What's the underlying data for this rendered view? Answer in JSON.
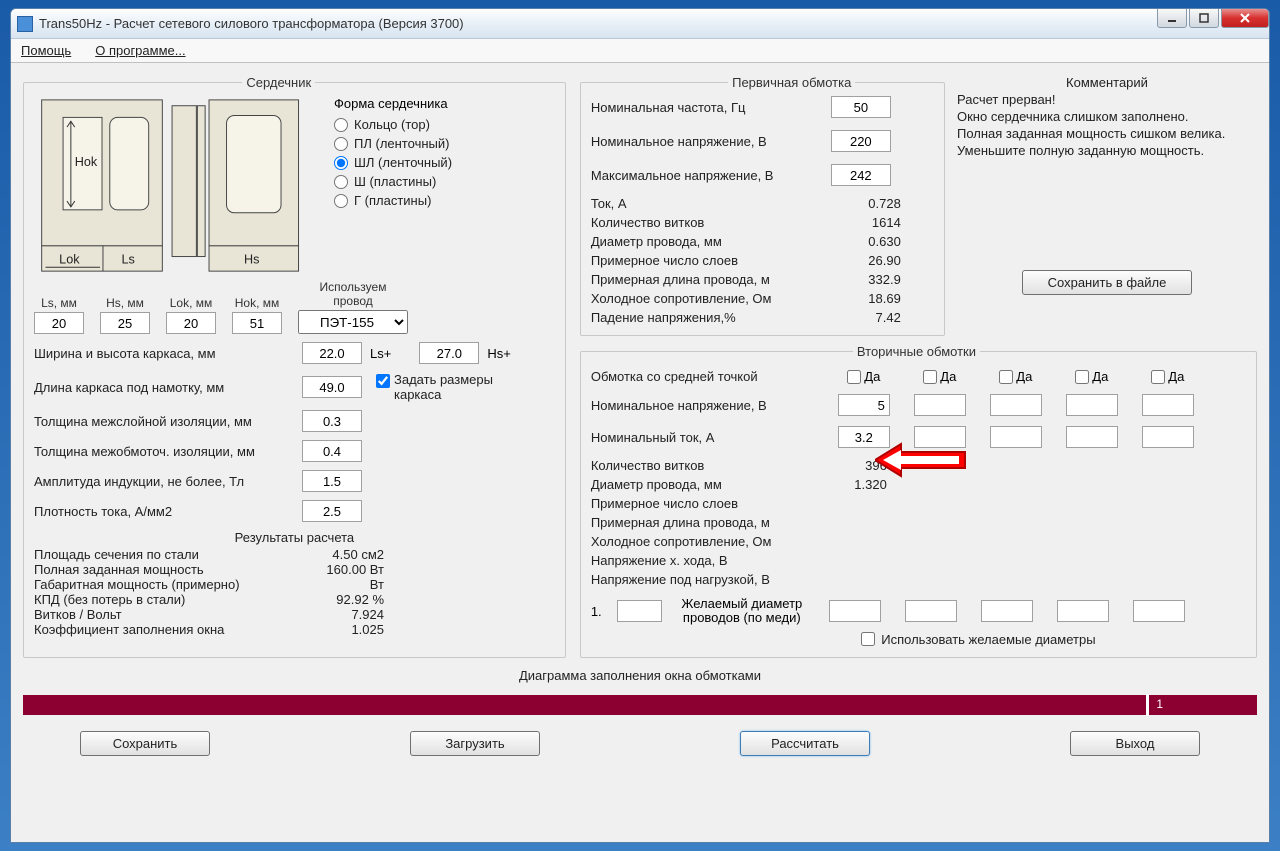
{
  "window": {
    "title": "Trans50Hz - Расчет сетевого силового трансформатора (Версия 3700)"
  },
  "menu": {
    "help": "Помощь",
    "about": "О программе..."
  },
  "core": {
    "legend": "Сердечник",
    "shape_label": "Форма сердечника",
    "shapes": {
      "ring": "Кольцо (тор)",
      "pl": "ПЛ (ленточный)",
      "shl": "ШЛ (ленточный)",
      "sh": "Ш  (пластины)",
      "g": "Г (пластины)"
    },
    "diagram": {
      "hok": "Hok",
      "lok": "Lok",
      "ls": "Ls",
      "hs": "Hs"
    },
    "wire_label1": "Используем",
    "wire_label2": "провод",
    "wire_select": "ПЭТ-155",
    "dims": {
      "ls_lbl": "Ls, мм",
      "ls": "20",
      "hs_lbl": "Hs, мм",
      "hs": "25",
      "lok_lbl": "Lok, мм",
      "lok": "20",
      "hok_lbl": "Hok, мм",
      "hok": "51"
    },
    "frame_wh_lbl": "Ширина и высота каркаса, мм",
    "frame_w": "22.0",
    "frame_w_suffix": "Ls+",
    "frame_h": "27.0",
    "frame_h_suffix": "Hs+",
    "frame_len_lbl": "Длина каркаса под намотку, мм",
    "frame_len": "49.0",
    "set_frame_lbl": "Задать размеры каркаса",
    "interlayer_lbl": "Толщина межслойной изоляции, мм",
    "interlayer": "0.3",
    "interwinding_lbl": "Толщина межобмоточ. изоляции, мм",
    "interwinding": "0.4",
    "induction_lbl": "Амплитуда индукции, не более, Тл",
    "induction": "1.5",
    "density_lbl": "Плотность тока, А/мм2",
    "density": "2.5",
    "results_title": "Результаты расчета",
    "results": {
      "area_lbl": "Площадь сечения по стали",
      "area": "4.50 см2",
      "pfull_lbl": "Полная заданная мощность",
      "pfull": "160.00 Вт",
      "pgab_lbl": "Габаритная мощность (примерно)",
      "pgab": "Вт",
      "kpd_lbl": "КПД (без потерь в стали)",
      "kpd": "92.92 %",
      "turns_lbl": "Витков / Вольт",
      "turns": "7.924",
      "fill_lbl": "Коэффициент заполнения окна",
      "fill": "1.025"
    }
  },
  "primary": {
    "legend": "Первичная обмотка",
    "freq_lbl": "Номинальная частота, Гц",
    "freq": "50",
    "vnom_lbl": "Номинальное напряжение, В",
    "vnom": "220",
    "vmax_lbl": "Максимальное напряжение, В",
    "vmax": "242",
    "i_lbl": "Ток, А",
    "i": "0.728",
    "turns_lbl": "Количество витков",
    "turns": "1614",
    "wdiam_lbl": "Диаметр провода, мм",
    "wdiam": "0.630",
    "layers_lbl": "Примерное число слоев",
    "layers": "26.90",
    "len_lbl": "Примерная длина провода, м",
    "len": "332.9",
    "coldr_lbl": "Холодное сопротивление, Ом",
    "coldr": "18.69",
    "vdrop_lbl": "Падение напряжения,%",
    "vdrop": "7.42"
  },
  "comment": {
    "title": "Комментарий",
    "l1": "Расчет прерван!",
    "l2": "Окно сердечника слишком заполнено.",
    "l3": "Полная заданная мощность сишком велика.",
    "l4": "Уменьшите полную заданную мощность."
  },
  "save_file_btn": "Сохранить в файле",
  "secondary": {
    "legend": "Вторичные обмотки",
    "midpoint_lbl": "Обмотка со средней точкой",
    "da": "Да",
    "vnom_lbl": "Номинальное напряжение, В",
    "vnom1": "5",
    "inom_lbl": "Номинальный ток, А",
    "inom1": "3.2",
    "turns_lbl": "Количество витков",
    "turns": "396",
    "wdiam_lbl": "Диаметр провода, мм",
    "wdiam": "1.320",
    "layers_lbl": "Примерное число слоев",
    "layers": "",
    "len_lbl": "Примерная длина провода, м",
    "len": "",
    "coldr_lbl": "Холодное сопротивление, Ом",
    "coldr": "",
    "vopen_lbl": "Напряжение х. хода, В",
    "vopen": "",
    "vload_lbl": "Напряжение под нагрузкой, В",
    "vload": "",
    "desired_lbl1": "Желаемый диаметр",
    "desired_lbl2": "проводов  (по меди)",
    "row_num": "1.",
    "use_desired_lbl": "Использовать желаемые диаметры"
  },
  "diag_lbl": "Диаграмма заполнения окна обмотками",
  "progress_marker": "1",
  "bottom": {
    "save": "Сохранить",
    "load": "Загрузить",
    "calc": "Рассчитать",
    "exit": "Выход"
  }
}
